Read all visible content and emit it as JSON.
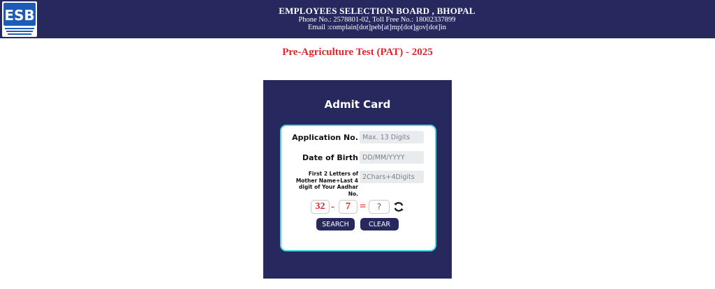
{
  "header": {
    "logo_name": "esb-logo",
    "logo_text": "ESB",
    "org_name": "EMPLOYEES SELECTION BOARD , BHOPAL",
    "phone_line": "Phone No.: 2578801-02, Toll Free No.: 18002337899",
    "email_line": "Email :complain[dot]peb[at]mp[dot]gov[dot]in",
    "background": "#26285e"
  },
  "exam_title": "Pre-Agriculture Test (PAT) - 2025",
  "admit_card": {
    "title": "Admit Card",
    "fields": {
      "application_label": "Application No.",
      "application_placeholder": "Max. 13 Digits",
      "dob_label": "Date of Birth",
      "dob_placeholder": "DD/MM/YYYY",
      "mother_label": "First 2 Letters of Mother Name+Last 4 digit of Your Aadhar No.",
      "mother_placeholder": "2Chars+4Digits"
    },
    "captcha": {
      "operand1": "32",
      "operator": "-",
      "operand2": "7",
      "equals": "=",
      "answer_placeholder": "?",
      "refresh_icon": "refresh-icon"
    },
    "buttons": {
      "search": "SEARCH",
      "clear": "CLEAR"
    }
  },
  "colors": {
    "navy": "#26285e",
    "title_red": "#e0262d",
    "card_border": "#4fd6df"
  }
}
